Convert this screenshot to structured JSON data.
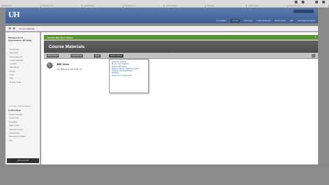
{
  "browser": {
    "tabs": [
      "Blackboard Learn",
      "Blackboard Learn",
      "Course Materials",
      "Blackboard Learn",
      "Course Materials",
      "Blackboard",
      "Course Materials",
      "Blackboard Learn"
    ]
  },
  "header": {
    "logo": "UH",
    "nav": [
      "My Institution",
      "Courses",
      "Community",
      "Content Collection",
      "System Admin",
      "UHD",
      "UH CougarNet Support"
    ]
  },
  "breadcrumb": {
    "label": "Course Materials"
  },
  "sidebar": {
    "course_title": "Management & Organizations (ST 2113)",
    "menu": [
      "Home Page",
      "Information",
      "Announcements",
      "Course Materials",
      "Contacts",
      "Discussions",
      "Groups",
      "Tools",
      "Help",
      "Teacher Guide"
    ],
    "course_management_heading": "COURSE MANAGEMENT",
    "control_panel": "Control Panel",
    "control_items": [
      "Content Collection",
      "Course Tools",
      "Evaluation",
      "Grade Center",
      "Users and Groups",
      "Customization",
      "Packages and Utilities",
      "Help"
    ],
    "quick_unenroll": "Quick Unenroll"
  },
  "notice": {
    "text": "Example BBC News Feature",
    "close": "✕"
  },
  "page": {
    "title": "Course Materials"
  },
  "toolbar": {
    "buttons": [
      "Build Content",
      "Assessments",
      "Tools",
      "Partner Content"
    ]
  },
  "item": {
    "title": "BBC News",
    "description": "The BBC News link to the UK"
  },
  "dropdown": {
    "items": [
      "Search for Textbook",
      "Browse Your Textbooks",
      "McGraw-Hill Content",
      "Pearson's MyLab / Mastering Content",
      "Cengage Learning MindTap™",
      "MindTap™",
      "Wiley & Sons' Content Tool"
    ]
  }
}
